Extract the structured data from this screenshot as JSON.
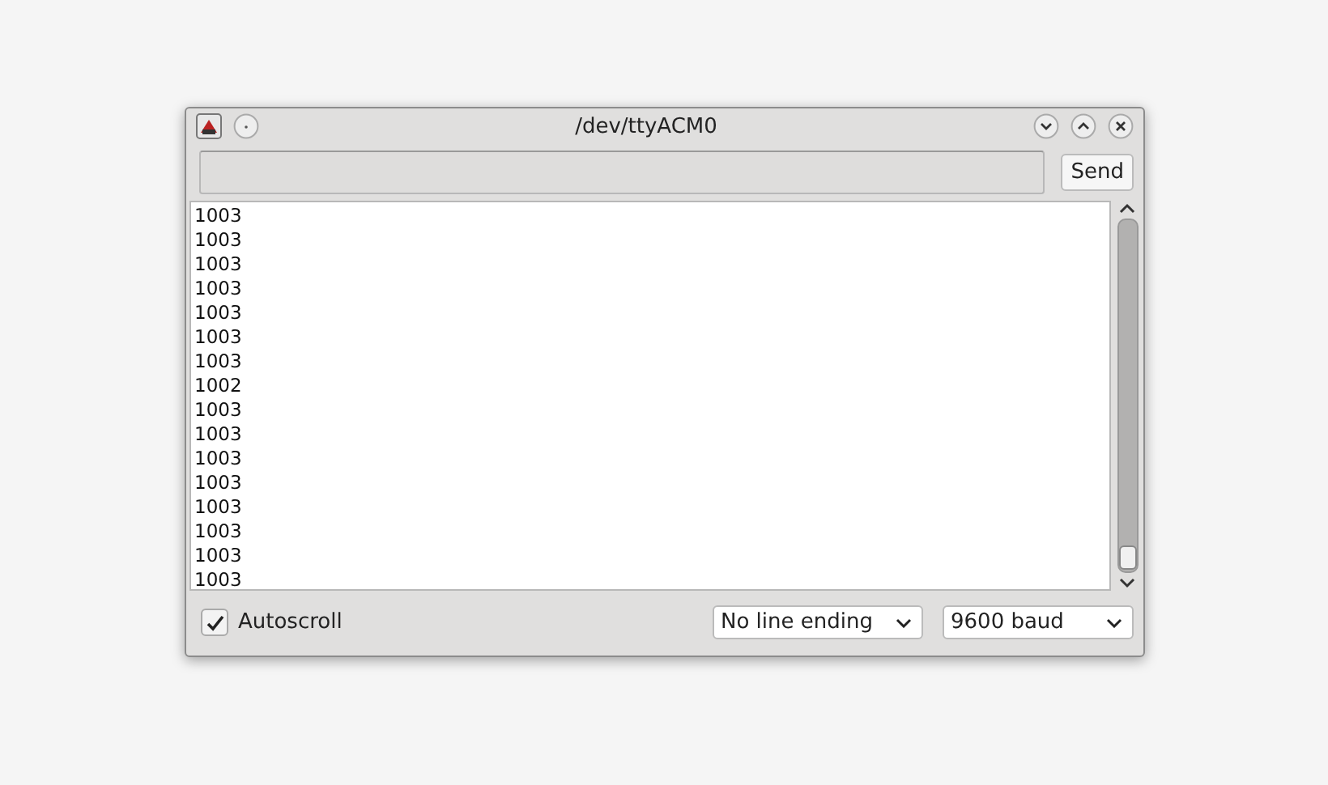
{
  "window": {
    "title": "/dev/ttyACM0"
  },
  "send_button": {
    "label": "Send"
  },
  "output_lines": [
    "1003",
    "1003",
    "1003",
    "1003",
    "1003",
    "1003",
    "1003",
    "1002",
    "1003",
    "1003",
    "1003",
    "1003",
    "1003",
    "1003",
    "1003",
    "1003"
  ],
  "autoscroll": {
    "label": "Autoscroll",
    "checked": true
  },
  "line_ending": {
    "value": "No line ending"
  },
  "baud": {
    "value": "9600 baud"
  }
}
